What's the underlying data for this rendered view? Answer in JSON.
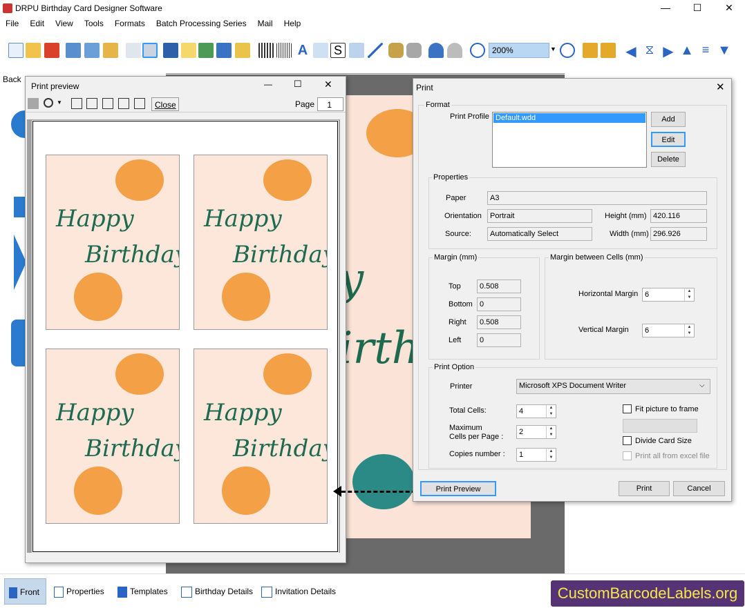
{
  "window": {
    "title": "DRPU Birthday Card Designer Software",
    "minimize": "—",
    "maximize": "☐",
    "close": "✕"
  },
  "menu": [
    "File",
    "Edit",
    "View",
    "Tools",
    "Formats",
    "Batch Processing Series",
    "Mail",
    "Help"
  ],
  "toolbar": {
    "zoom": "200%"
  },
  "left_panel": {
    "tab": "Back"
  },
  "card_text": {
    "line1": "Happy",
    "line2": "Birthday",
    "bg_partial1": "y",
    "bg_partial2": "irth"
  },
  "print_preview": {
    "title": "Print preview",
    "close_label": "Close",
    "page_label": "Page",
    "page_value": "1"
  },
  "print_dialog": {
    "title": "Print",
    "format_label": "Format",
    "profile_label": "Print Profile",
    "profile_selected": "Default.wdd",
    "add": "Add",
    "edit": "Edit",
    "delete": "Delete",
    "properties_label": "Properties",
    "paper_label": "Paper",
    "paper_value": "A3",
    "orientation_label": "Orientation",
    "orientation_value": "Portrait",
    "height_label": "Height (mm)",
    "height_value": "420.116",
    "source_label": "Source:",
    "source_value": "Automatically Select",
    "width_label": "Width (mm)",
    "width_value": "296.926",
    "margin_label": "Margin (mm)",
    "top_label": "Top",
    "top_value": "0.508",
    "bottom_label": "Bottom",
    "bottom_value": "0",
    "right_label": "Right",
    "right_value": "0.508",
    "left_label": "Left",
    "left_value": "0",
    "cell_margin_label": "Margin between Cells (mm)",
    "hmargin_label": "Horizontal Margin",
    "hmargin_value": "6",
    "vmargin_label": "Vertical Margin",
    "vmargin_value": "6",
    "print_option_label": "Print Option",
    "printer_label": "Printer",
    "printer_value": "Microsoft XPS Document Writer",
    "total_cells_label": "Total Cells:",
    "total_cells_value": "4",
    "max_cells_label1": "Maximum",
    "max_cells_label2": "Cells per Page :",
    "max_cells_value": "2",
    "copies_label": "Copies number :",
    "copies_value": "1",
    "fit_picture": "Fit picture to frame",
    "divide_card": "Divide Card Size",
    "print_all_excel": "Print all from excel file",
    "print_preview_btn": "Print Preview",
    "print_btn": "Print",
    "cancel_btn": "Cancel"
  },
  "bottom_tabs": [
    "Front",
    "Properties",
    "Templates",
    "Birthday Details",
    "Invitation Details"
  ],
  "brand": "CustomBarcodeLabels.org",
  "colors": {
    "accent": "#3399ff",
    "card_bg": "#fde7da",
    "text_green": "#1d6a50",
    "brand_bg": "#553374",
    "brand_fg": "#f4e84a"
  }
}
